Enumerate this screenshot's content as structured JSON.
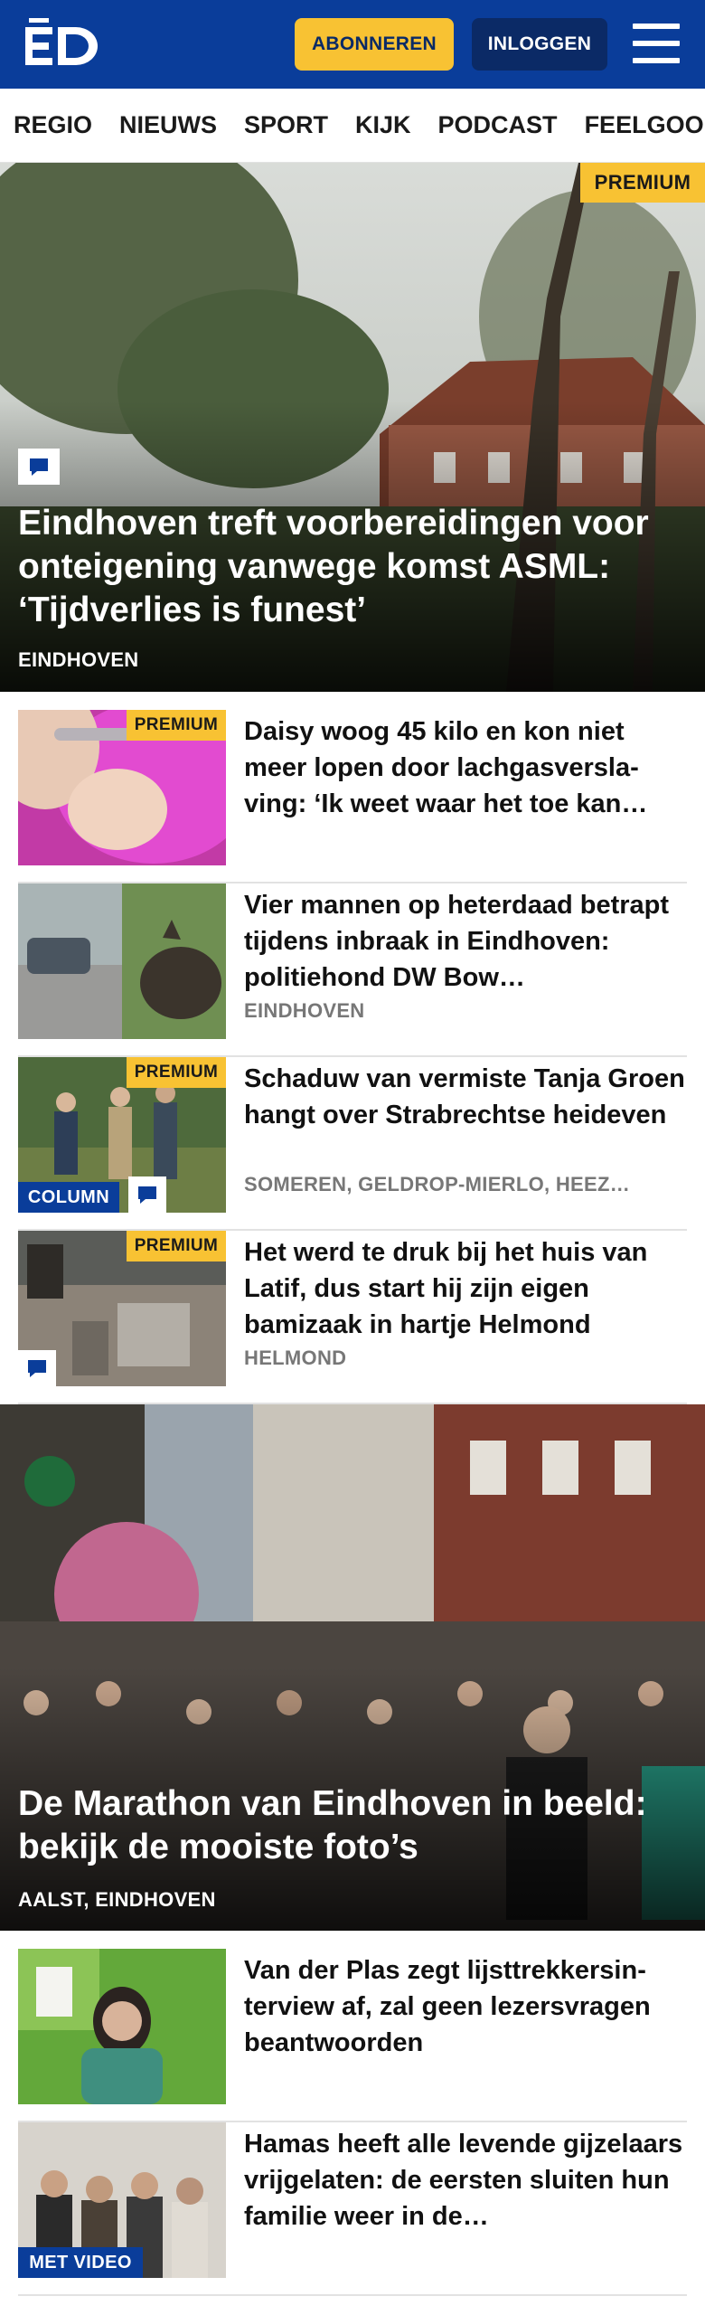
{
  "header": {
    "logo_text": "ED",
    "subscribe_label": "ABONNEREN",
    "login_label": "INLOGGEN",
    "menu_icon": "hamburger-menu-icon",
    "colors": {
      "brand_blue": "#0a3d9a",
      "subscribe_yellow": "#f8c233",
      "login_navy": "#0b2a66"
    }
  },
  "nav": {
    "items": [
      "REGIO",
      "NIEUWS",
      "SPORT",
      "KIJK",
      "PODCAST",
      "FEELGOOD"
    ]
  },
  "hero": {
    "badge": "PREMIUM",
    "comment_icon": "comment-icon",
    "title": "Eindhoven treft voorbereidingen voor onteigening vanwege komst ASML: ‘Tijdverlies is funest’",
    "location": "EINDHOVEN"
  },
  "articles": [
    {
      "badge": "PREMIUM",
      "title": "Daisy woog 45 kilo en kon niet meer lopen door lachgasversla­ving: ‘Ik weet waar het toe kan…",
      "location": ""
    },
    {
      "badge": "",
      "title": "Vier mannen op heterdaad betrapt tijdens inbraak in Eindhoven: politiehond DW Bow…",
      "location": "EINDHOVEN"
    },
    {
      "badge": "PREMIUM",
      "label": "COLUMN",
      "title": "Schaduw van vermiste Tanja Groen hangt over Strabrechtse heideven",
      "location": "SOMEREN, GELDROP-MIERLO, HEEZ…"
    },
    {
      "badge": "PREMIUM",
      "title": "Het werd te druk bij het huis van Latif, dus start hij zijn eigen bamizaak in hartje Helmond",
      "location": "HELMOND"
    }
  ],
  "hero2": {
    "title": "De Marathon van Eindhoven in beeld: bekijk de mooiste foto’s",
    "location": "AALST, EINDHOVEN"
  },
  "articles2": [
    {
      "title": "Van der Plas zegt lijsttrekkersin­terview af, zal geen lezersvragen beantwoorden",
      "location": ""
    },
    {
      "label": "MET VIDEO",
      "title": "Hamas heeft alle levende gijzelaars vrijgelaten: de eersten sluiten hun familie weer in de…",
      "location": ""
    }
  ]
}
